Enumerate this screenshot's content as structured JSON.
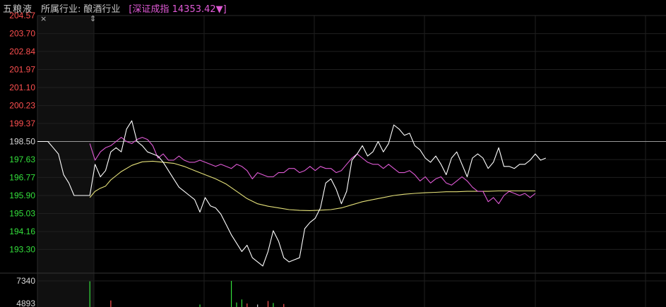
{
  "header": {
    "stock_name": "五粮液",
    "industry_label": "所属行业:",
    "industry_name": "酿酒行业",
    "index_text": "[深证成指 14353.42▼]"
  },
  "controls": {
    "close_glyph": "×",
    "resize_glyph": "⇕"
  },
  "colors": {
    "up": "#ff5050",
    "down": "#34e03c",
    "neutral": "#d8d8d8",
    "price_line": "#ffffff",
    "avg_line": "#e6e27a",
    "index_line": "#e05ad6",
    "grid": "#1f1f1f",
    "baseline": "#9a9a9a"
  },
  "chart_data": {
    "type": "line",
    "ylim": [
      192.43,
      204.57
    ],
    "reference_price": 198.5,
    "ytick_labels": [
      "204.57",
      "203.70",
      "202.84",
      "201.97",
      "201.10",
      "200.23",
      "199.37",
      "198.50",
      "197.63",
      "196.77",
      "195.90",
      "195.03",
      "194.16",
      "193.30"
    ],
    "ytick_values": [
      204.57,
      203.7,
      202.84,
      201.97,
      201.1,
      200.23,
      199.37,
      198.5,
      197.63,
      196.77,
      195.9,
      195.03,
      194.16,
      193.3
    ],
    "x_range": [
      0,
      95
    ],
    "series": [
      {
        "key": "price",
        "x": [
          0,
          1,
          2,
          3,
          4,
          5,
          6,
          7,
          8,
          9,
          10,
          11,
          12,
          13,
          14,
          15,
          16,
          17,
          18,
          19,
          20,
          21,
          22,
          23,
          24,
          25,
          26,
          27,
          28,
          29,
          30,
          31,
          32,
          33,
          34,
          35,
          36,
          37,
          38,
          39,
          40,
          41,
          42,
          43,
          44,
          45,
          46,
          47,
          48,
          49,
          50,
          51,
          52,
          53,
          54,
          55,
          56,
          57,
          58,
          59,
          60,
          61,
          62,
          63,
          64,
          65,
          66,
          67,
          68,
          69,
          70,
          71,
          72,
          73,
          74,
          75,
          76,
          77,
          78,
          79,
          80,
          81,
          82,
          83,
          84,
          85,
          86,
          87,
          88,
          89,
          90,
          91,
          92,
          93,
          94,
          95,
          96,
          97
        ],
        "values": [
          198.5,
          198.5,
          198.5,
          198.2,
          197.9,
          196.9,
          196.5,
          195.9,
          195.9,
          195.9,
          195.9,
          197.4,
          196.8,
          197.1,
          198.0,
          198.2,
          198.0,
          199.1,
          199.5,
          198.5,
          198.3,
          198.0,
          197.9,
          197.8,
          197.5,
          197.1,
          196.7,
          196.3,
          196.1,
          195.9,
          195.7,
          195.1,
          195.8,
          195.4,
          195.3,
          195.0,
          194.5,
          194.0,
          193.6,
          193.2,
          193.5,
          192.9,
          192.7,
          192.5,
          193.2,
          194.2,
          193.7,
          192.9,
          192.7,
          192.8,
          192.9,
          194.3,
          194.6,
          194.8,
          195.3,
          196.5,
          196.7,
          196.2,
          195.5,
          196.1,
          197.6,
          197.9,
          198.3,
          197.8,
          198.0,
          198.5,
          198.0,
          198.4,
          199.3,
          199.1,
          198.8,
          198.9,
          198.3,
          198.1,
          197.7,
          197.5,
          197.8,
          197.4,
          196.9,
          197.7,
          198.0,
          197.4,
          196.8,
          197.7,
          197.9,
          197.7,
          197.2,
          197.5,
          198.2,
          197.3,
          197.3,
          197.2,
          197.4,
          197.4,
          197.6,
          197.9,
          197.6,
          197.7
        ]
      },
      {
        "key": "average",
        "x": [
          10,
          11,
          12,
          13,
          14,
          15,
          16,
          18,
          20,
          22,
          24,
          26,
          28,
          30,
          32,
          34,
          36,
          38,
          40,
          42,
          44,
          46,
          48,
          50,
          52,
          54,
          56,
          58,
          60,
          62,
          64,
          66,
          68,
          70,
          72,
          74,
          76,
          78,
          80,
          82,
          84,
          86,
          88,
          90,
          92,
          95
        ],
        "values": [
          195.8,
          196.1,
          196.25,
          196.35,
          196.65,
          196.85,
          197.05,
          197.35,
          197.52,
          197.55,
          197.5,
          197.45,
          197.3,
          197.1,
          196.9,
          196.7,
          196.45,
          196.1,
          195.75,
          195.5,
          195.38,
          195.3,
          195.22,
          195.18,
          195.17,
          195.19,
          195.22,
          195.3,
          195.45,
          195.6,
          195.7,
          195.8,
          195.9,
          195.96,
          196.0,
          196.03,
          196.05,
          196.08,
          196.08,
          196.1,
          196.1,
          196.1,
          196.12,
          196.12,
          196.12,
          196.12
        ]
      },
      {
        "key": "index",
        "x": [
          10,
          11,
          12,
          13,
          14,
          15,
          16,
          17,
          18,
          19,
          20,
          21,
          22,
          23,
          24,
          25,
          26,
          27,
          28,
          29,
          30,
          31,
          32,
          33,
          34,
          35,
          36,
          37,
          38,
          39,
          40,
          41,
          42,
          43,
          44,
          45,
          46,
          47,
          48,
          49,
          50,
          51,
          52,
          53,
          54,
          55,
          56,
          57,
          58,
          59,
          60,
          61,
          62,
          63,
          64,
          65,
          66,
          67,
          68,
          69,
          70,
          71,
          72,
          73,
          74,
          75,
          76,
          77,
          78,
          79,
          80,
          81,
          82,
          83,
          84,
          85,
          86,
          87,
          88,
          89,
          90,
          91,
          92,
          93,
          94,
          95
        ],
        "values": [
          198.4,
          197.6,
          198.0,
          198.2,
          198.3,
          198.5,
          198.7,
          198.5,
          198.4,
          198.6,
          198.7,
          198.6,
          198.3,
          197.7,
          197.9,
          197.6,
          197.6,
          197.8,
          197.6,
          197.5,
          197.5,
          197.6,
          197.5,
          197.4,
          197.3,
          197.4,
          197.3,
          197.2,
          197.4,
          197.3,
          197.1,
          196.7,
          197.0,
          196.9,
          196.8,
          196.8,
          197.0,
          197.0,
          197.2,
          197.2,
          197.0,
          197.1,
          197.3,
          197.1,
          197.3,
          197.2,
          197.2,
          197.0,
          197.1,
          197.4,
          197.7,
          197.9,
          197.7,
          197.5,
          197.4,
          197.4,
          197.2,
          197.4,
          197.2,
          197.0,
          197.0,
          197.1,
          196.9,
          196.6,
          196.8,
          196.5,
          196.7,
          196.8,
          196.5,
          196.4,
          196.6,
          196.8,
          196.6,
          196.3,
          196.1,
          196.1,
          195.6,
          195.8,
          195.5,
          195.9,
          196.1,
          196.0,
          195.9,
          196.0,
          195.8,
          196.0
        ]
      }
    ],
    "volume": {
      "ytick_labels": [
        "7340",
        "4893"
      ],
      "ytick_values": [
        7340,
        4893
      ],
      "ylim": [
        4893,
        7340
      ],
      "bars": [
        {
          "x": 10,
          "value": 7300,
          "dir": "down"
        },
        {
          "x": 14,
          "value": 5400,
          "dir": "up"
        },
        {
          "x": 31,
          "value": 5000,
          "dir": "down"
        },
        {
          "x": 37,
          "value": 7340,
          "dir": "down"
        },
        {
          "x": 38,
          "value": 5200,
          "dir": "down"
        },
        {
          "x": 39,
          "value": 5500,
          "dir": "down"
        },
        {
          "x": 40,
          "value": 5100,
          "dir": "up"
        },
        {
          "x": 42,
          "value": 5000,
          "dir": "neutral"
        },
        {
          "x": 44,
          "value": 5350,
          "dir": "up"
        },
        {
          "x": 45,
          "value": 5150,
          "dir": "down"
        },
        {
          "x": 47,
          "value": 5050,
          "dir": "up"
        }
      ]
    }
  }
}
